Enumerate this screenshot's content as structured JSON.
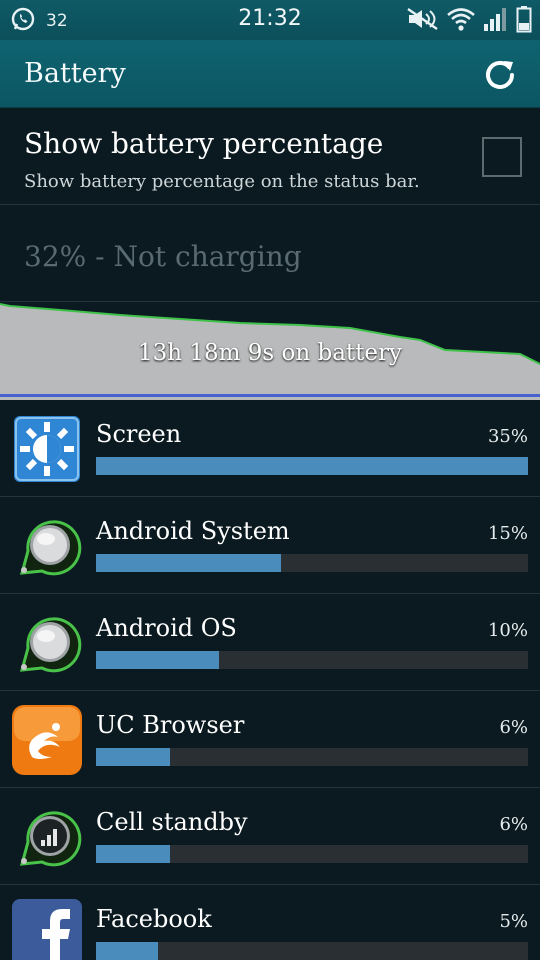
{
  "status_bar": {
    "notification_count": "32",
    "time": "21:32",
    "icons": [
      "viber-icon",
      "mute-icon",
      "wifi-icon",
      "signal-icon",
      "battery-icon"
    ]
  },
  "action_bar": {
    "title": "Battery",
    "refresh_icon": "refresh-icon"
  },
  "setting": {
    "title": "Show battery percentage",
    "subtitle": "Show battery percentage on the status bar.",
    "checked": false
  },
  "battery_status": "32% - Not charging",
  "graph": {
    "caption": "13h 18m 9s on battery",
    "colors": {
      "fill": "#b9babb",
      "line": "#3fc24a",
      "background": "#0b1a20"
    }
  },
  "usage": [
    {
      "name": "Screen",
      "percent": "35%",
      "value": 35,
      "icon": "screen-brightness-icon"
    },
    {
      "name": "Android System",
      "percent": "15%",
      "value": 15,
      "icon": "android-system-icon"
    },
    {
      "name": "Android OS",
      "percent": "10%",
      "value": 10,
      "icon": "android-os-icon"
    },
    {
      "name": "UC Browser",
      "percent": "6%",
      "value": 6,
      "icon": "uc-browser-icon"
    },
    {
      "name": "Cell standby",
      "percent": "6%",
      "value": 6,
      "icon": "cell-standby-icon"
    },
    {
      "name": "Facebook",
      "percent": "5%",
      "value": 5,
      "icon": "facebook-icon"
    }
  ],
  "colors": {
    "accent": "#0f6370",
    "bar_fill": "#4a8cbc",
    "bar_track": "#2a2f33"
  }
}
